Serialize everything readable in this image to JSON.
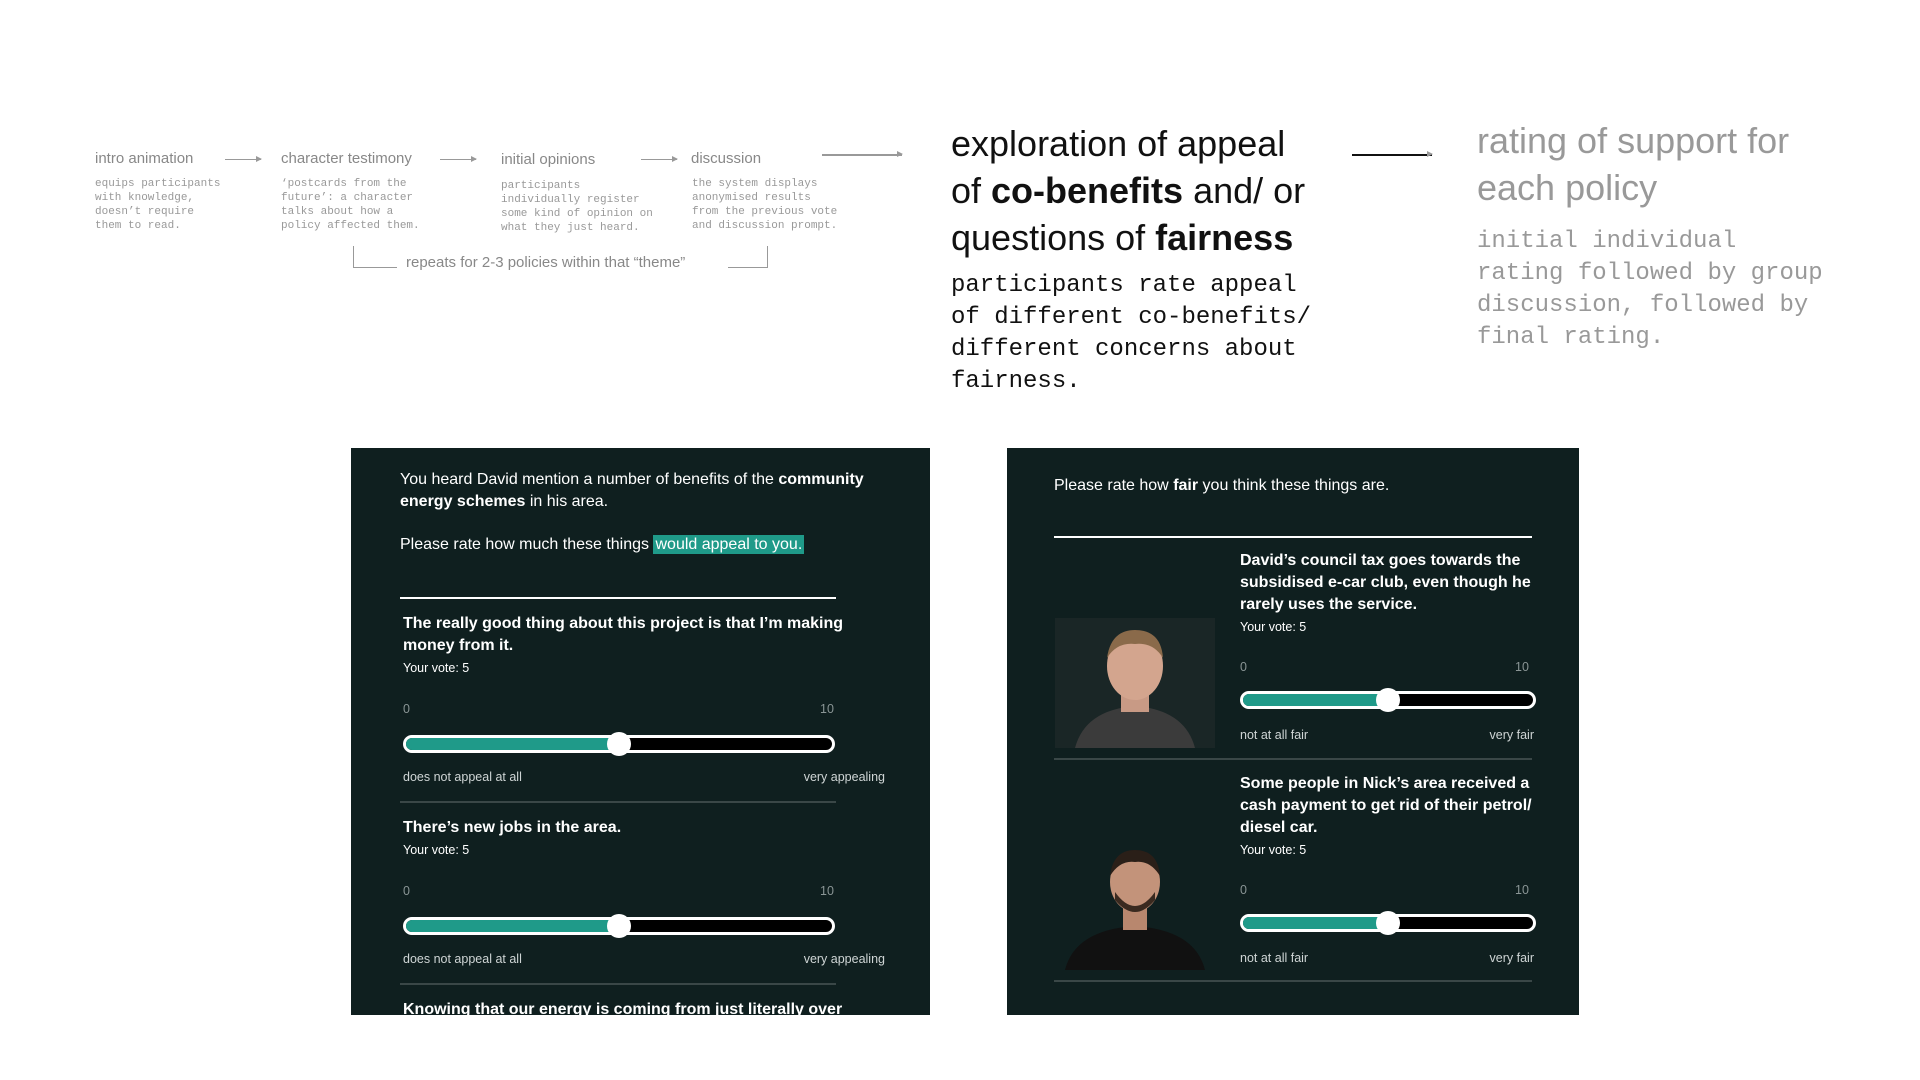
{
  "flow": {
    "steps": [
      {
        "title": "intro animation",
        "desc": "equips participants\nwith knowledge,\ndoesn’t require\nthem to read."
      },
      {
        "title": "character testimony",
        "desc": "‘postcards from the\nfuture’: a character\ntalks about how a\npolicy affected them."
      },
      {
        "title": "initial opinions",
        "desc": "participants\nindividually register\nsome kind of opinion on\nwhat they just heard."
      },
      {
        "title": "discussion",
        "desc": "the system displays\nanonymised results\nfrom the previous vote\nand discussion prompt."
      }
    ],
    "repeat_note": "repeats for 2-3 policies within that “theme”"
  },
  "exploration": {
    "title_parts": [
      "exploration of appeal of ",
      "co-benefits",
      " and/ or questions of ",
      "fairness"
    ],
    "desc": "participants rate appeal\nof different co-benefits/\ndifferent concerns about\nfairness."
  },
  "rating": {
    "title": "rating of support for each policy",
    "desc": "initial individual\nrating followed by group\ndiscussion, followed by\nfinal rating."
  },
  "appeal_panel": {
    "intro_a": "You heard David mention a number of benefits of the ",
    "intro_bold": "community energy schemes",
    "intro_b": " in his area.",
    "prompt": "Please rate how much these things ",
    "prompt_highlight": "would appeal to you.",
    "items": [
      {
        "statement": "The really good thing about this project is that I’m making money from it.",
        "vote": "Your vote: 5",
        "value": 5,
        "min": "0",
        "max": "10",
        "low": "does not appeal at all",
        "high": "very appealing"
      },
      {
        "statement": "There’s new jobs in the area.",
        "vote": "Your vote: 5",
        "value": 5,
        "min": "0",
        "max": "10",
        "low": "does not appeal at all",
        "high": "very appealing"
      },
      {
        "statement": "Knowing that our energy is coming from just literally over"
      }
    ]
  },
  "fair_panel": {
    "prompt_a": "Please rate how ",
    "prompt_bold": "fair",
    "prompt_b": " you think these things are.",
    "items": [
      {
        "statement": "David’s council tax goes towards the subsidised e-car club, even though he rarely uses the service.",
        "vote": "Your vote: 5",
        "value": 5,
        "min": "0",
        "max": "10",
        "low": "not at all fair",
        "high": "very fair"
      },
      {
        "statement": "Some people in Nick’s area received a cash payment to get rid of their petrol/ diesel car.",
        "vote": "Your vote: 5",
        "value": 5,
        "min": "0",
        "max": "10",
        "low": "not at all fair",
        "high": "very fair"
      }
    ]
  },
  "colors": {
    "panel_bg": "#0f1f1f",
    "accent": "#1f9a89"
  }
}
